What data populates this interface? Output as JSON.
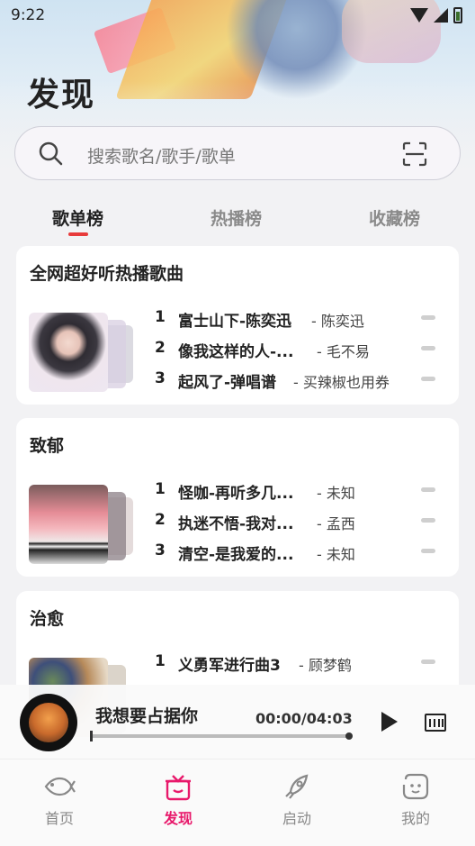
{
  "status_bar": {
    "time": "9:22"
  },
  "page": {
    "title": "发现"
  },
  "search": {
    "placeholder": "搜索歌名/歌手/歌单"
  },
  "tabs": [
    {
      "label": "歌单榜",
      "active": true
    },
    {
      "label": "热播榜",
      "active": false
    },
    {
      "label": "收藏榜",
      "active": false
    }
  ],
  "cards": [
    {
      "title": "全网超好听热播歌曲",
      "songs": [
        {
          "num": "1",
          "name": "富士山下-陈奕迅",
          "artist": "陈奕迅"
        },
        {
          "num": "2",
          "name": "像我这样的人-...",
          "artist": "毛不易"
        },
        {
          "num": "3",
          "name": "起风了-弹唱谱",
          "artist": "买辣椒也用券"
        }
      ]
    },
    {
      "title": "致郁",
      "songs": [
        {
          "num": "1",
          "name": "怪咖-再听多几...",
          "artist": "未知"
        },
        {
          "num": "2",
          "name": "执迷不悟-我对...",
          "artist": "孟西"
        },
        {
          "num": "3",
          "name": "清空-是我爱的...",
          "artist": "未知"
        }
      ]
    },
    {
      "title": "治愈",
      "songs": [
        {
          "num": "1",
          "name": "义勇军进行曲3",
          "artist": "顾梦鹤"
        }
      ]
    }
  ],
  "player": {
    "song_title": "我想要占据你",
    "time": "00:00/04:03",
    "progress": 0.0
  },
  "nav": [
    {
      "label": "首页",
      "icon": "fish-icon",
      "active": false
    },
    {
      "label": "发现",
      "icon": "gift-box-icon",
      "active": true
    },
    {
      "label": "启动",
      "icon": "rocket-icon",
      "active": false
    },
    {
      "label": "我的",
      "icon": "smiley-icon",
      "active": false
    }
  ],
  "colors": {
    "accent": "#e8196b",
    "tab_underline": "#e83b3b"
  }
}
